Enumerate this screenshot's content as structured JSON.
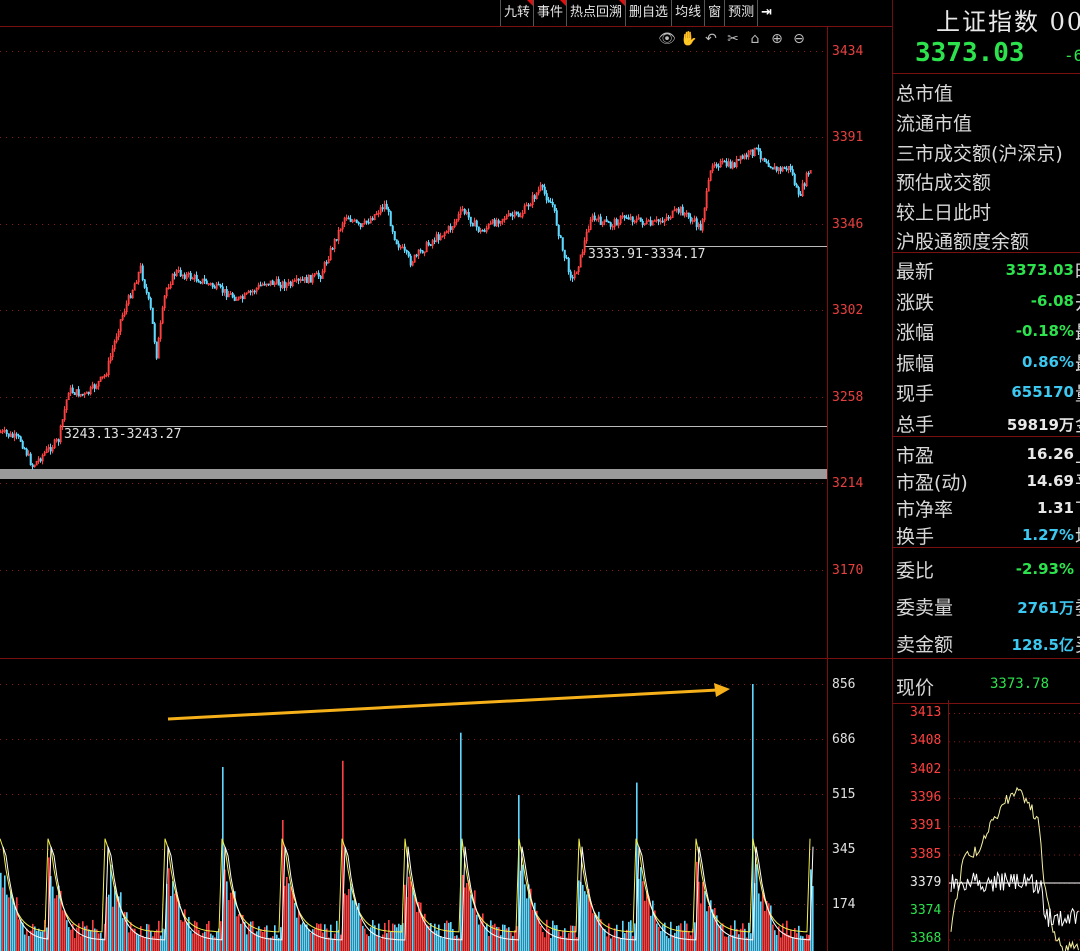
{
  "toolbar": {
    "buttons": [
      "九转",
      "事件",
      "热点回溯",
      "删自选",
      "均线",
      "窗",
      "预测"
    ],
    "arrow_label": "⇥"
  },
  "chart_tools": [
    "eye-icon",
    "hand-icon",
    "undo-icon",
    "scissors-icon",
    "lock-icon",
    "zoom-in-icon",
    "zoom-out-icon"
  ],
  "price_axis": [
    "3434",
    "3391",
    "3346",
    "3302",
    "3258",
    "3214",
    "3170"
  ],
  "volume_axis": [
    "856",
    "686",
    "515",
    "345",
    "174"
  ],
  "range_labels": {
    "upper": "3333.91-3334.17",
    "lower": "3243.13-3243.27"
  },
  "quote": {
    "title": "上证指数 00",
    "price": "3373.03",
    "change_partial": "-6"
  },
  "summary_labels": [
    "总市值",
    "流通市值",
    "三市成交额(沪深京)",
    "预估成交额",
    "较上日此时",
    "沪股通额度余额"
  ],
  "stats_a": [
    {
      "label": "最新",
      "value": "3373.03",
      "color": "g",
      "right": "昨收"
    },
    {
      "label": "涨跌",
      "value": "-6.08",
      "color": "g",
      "right": "开盘"
    },
    {
      "label": "涨幅",
      "value": "-0.18%",
      "color": "g",
      "right": "最高"
    },
    {
      "label": "振幅",
      "value": "0.86%",
      "color": "c",
      "right": "最低"
    },
    {
      "label": "现手",
      "value": "655170",
      "color": "c",
      "right": "量比"
    },
    {
      "label": "总手",
      "value": "59819万",
      "color": "w",
      "right": "金额"
    }
  ],
  "stats_b": [
    {
      "label": "市盈",
      "value": "16.26",
      "color": "w",
      "right": "上涨"
    },
    {
      "label": "市盈(动)",
      "value": "14.69",
      "color": "w",
      "right": "平盘"
    },
    {
      "label": "市净率",
      "value": "1.31",
      "color": "w",
      "right": "下跌"
    },
    {
      "label": "换手",
      "value": "1.27%",
      "color": "c",
      "right": "均价"
    }
  ],
  "stats_c": [
    {
      "label": "委比",
      "value": "-2.93%",
      "color": "g",
      "right": ""
    },
    {
      "label": "委卖量",
      "value": "2761万",
      "color": "c",
      "right": "委买"
    },
    {
      "label": "卖金额",
      "value": "128.5亿",
      "color": "c",
      "right": "买金"
    }
  ],
  "mini_chart": {
    "label": "现价",
    "value": "3373.78",
    "axis": [
      "3413",
      "3408",
      "3402",
      "3396",
      "3391",
      "3385",
      "3379",
      "3374",
      "3368"
    ]
  },
  "colors": {
    "up": "#ff3b3b",
    "down": "#2ce34d",
    "cyan": "#3cc8f0",
    "grid": "#7a1010"
  }
}
